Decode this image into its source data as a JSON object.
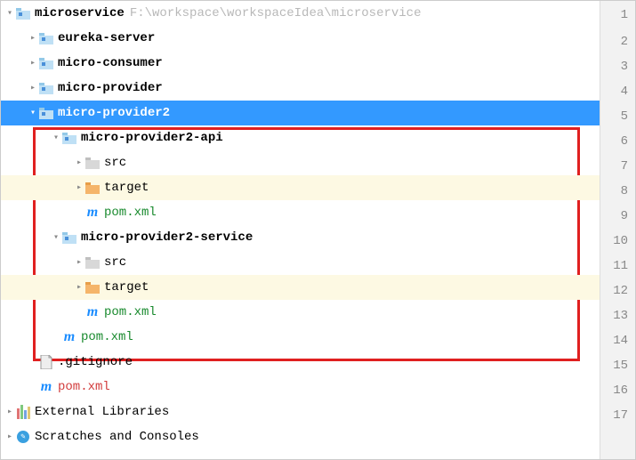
{
  "root": {
    "name": "microservice",
    "path": "F:\\workspace\\workspaceIdea\\microservice"
  },
  "modules": {
    "eureka": "eureka-server",
    "consumer": "micro-consumer",
    "provider": "micro-provider",
    "provider2": "micro-provider2",
    "provider2_api": "micro-provider2-api",
    "provider2_service": "micro-provider2-service"
  },
  "dirs": {
    "src": "src",
    "target": "target"
  },
  "files": {
    "pom": "pom.xml",
    "gitignore": ".gitignore"
  },
  "other": {
    "ext_lib": "External Libraries",
    "scratches": "Scratches and Consoles"
  },
  "gutter": [
    "1",
    "2",
    "3",
    "4",
    "5",
    "6",
    "7",
    "8",
    "9",
    "10",
    "11",
    "12",
    "13",
    "14",
    "15",
    "16",
    "17"
  ]
}
